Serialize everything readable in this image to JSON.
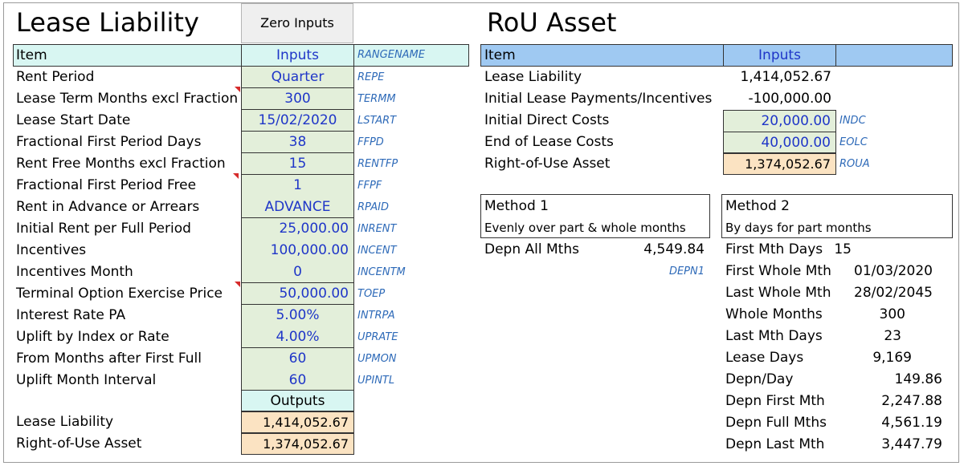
{
  "left": {
    "title": "Lease Liability",
    "zero_inputs_label": "Zero Inputs",
    "header": {
      "item": "Item",
      "inputs": "Inputs",
      "rangename": "RANGENAME"
    },
    "rows": [
      {
        "label": "Rent Period",
        "value": "Quarter",
        "code": "REPE"
      },
      {
        "label": "Lease Term Months excl Fraction",
        "value": "300",
        "code": "TERMM"
      },
      {
        "label": "Lease Start Date",
        "value": "15/02/2020",
        "code": "LSTART"
      },
      {
        "label": "Fractional First Period Days",
        "value": "38",
        "code": "FFPD"
      },
      {
        "label": "Rent Free Months excl Fraction",
        "value": "15",
        "code": "RENTFP"
      },
      {
        "label": "Fractional First Period Free",
        "value": "1",
        "code": "FFPF"
      },
      {
        "label": "Rent in Advance or Arrears",
        "value": "ADVANCE",
        "code": "RPAID"
      },
      {
        "label": "Initial Rent per Full Period",
        "value": "25,000.00",
        "code": "INRENT"
      },
      {
        "label": "Incentives",
        "value": "100,000.00",
        "code": "INCENT"
      },
      {
        "label": "Incentives Month",
        "value": "0",
        "code": "INCENTM"
      },
      {
        "label": "Terminal Option Exercise Price",
        "value": "50,000.00",
        "code": "TOEP"
      },
      {
        "label": "Interest Rate PA",
        "value": "5.00%",
        "code": "INTRPA"
      },
      {
        "label": "Uplift by Index or Rate",
        "value": "4.00%",
        "code": "UPRATE"
      },
      {
        "label": "From Months after First Full",
        "value": "60",
        "code": "UPMON"
      },
      {
        "label": "Uplift Month Interval",
        "value": "60",
        "code": "UPINTL"
      }
    ],
    "outputs_label": "Outputs",
    "outputs": [
      {
        "label": "Lease Liability",
        "value": "1,414,052.67"
      },
      {
        "label": "Right-of-Use Asset",
        "value": "1,374,052.67"
      }
    ]
  },
  "right": {
    "title": "RoU Asset",
    "header": {
      "item": "Item",
      "inputs": "Inputs"
    },
    "rows": [
      {
        "label": "Lease Liability",
        "value": "1,414,052.67",
        "code": ""
      },
      {
        "label": "Initial Lease Payments/Incentives",
        "value": "-100,000.00",
        "code": ""
      },
      {
        "label": "Initial Direct Costs",
        "value": "20,000.00",
        "code": "INDC"
      },
      {
        "label": "End of Lease Costs",
        "value": "40,000.00",
        "code": "EOLC"
      },
      {
        "label": "Right-of-Use Asset",
        "value": "1,374,052.67",
        "code": "ROUA"
      }
    ],
    "method1": {
      "title": "Method 1",
      "subtitle": "Evenly over part & whole months",
      "depn_label": "Depn All Mths",
      "depn_value": "4,549.84",
      "depn_code": "DEPN1"
    },
    "method2": {
      "title": "Method 2",
      "subtitle": "By days for part months",
      "rows": [
        {
          "label": "First Mth Days",
          "value": "15"
        },
        {
          "label": "First Whole Mth",
          "value": "01/03/2020"
        },
        {
          "label": "Last Whole Mth",
          "value": "28/02/2045"
        },
        {
          "label": "Whole Months",
          "value": "300"
        },
        {
          "label": "Last Mth Days",
          "value": "23"
        },
        {
          "label": "Lease Days",
          "value": "9,169"
        },
        {
          "label": "Depn/Day",
          "value": "149.86"
        },
        {
          "label": "Depn First Mth",
          "value": "2,247.88"
        },
        {
          "label": "Depn Full Mths",
          "value": "4,561.19"
        },
        {
          "label": "Depn Last Mth",
          "value": "3,447.79"
        }
      ]
    }
  },
  "colors": {
    "input_fill": "#e3efda",
    "output_fill": "#fbe3c2",
    "left_header_fill": "#d8f6f2",
    "right_header_fill": "#9fc9f2",
    "input_text": "#1f36c8",
    "rangename_text": "#2e6ab8",
    "comment_marker": "#d62b2b"
  }
}
